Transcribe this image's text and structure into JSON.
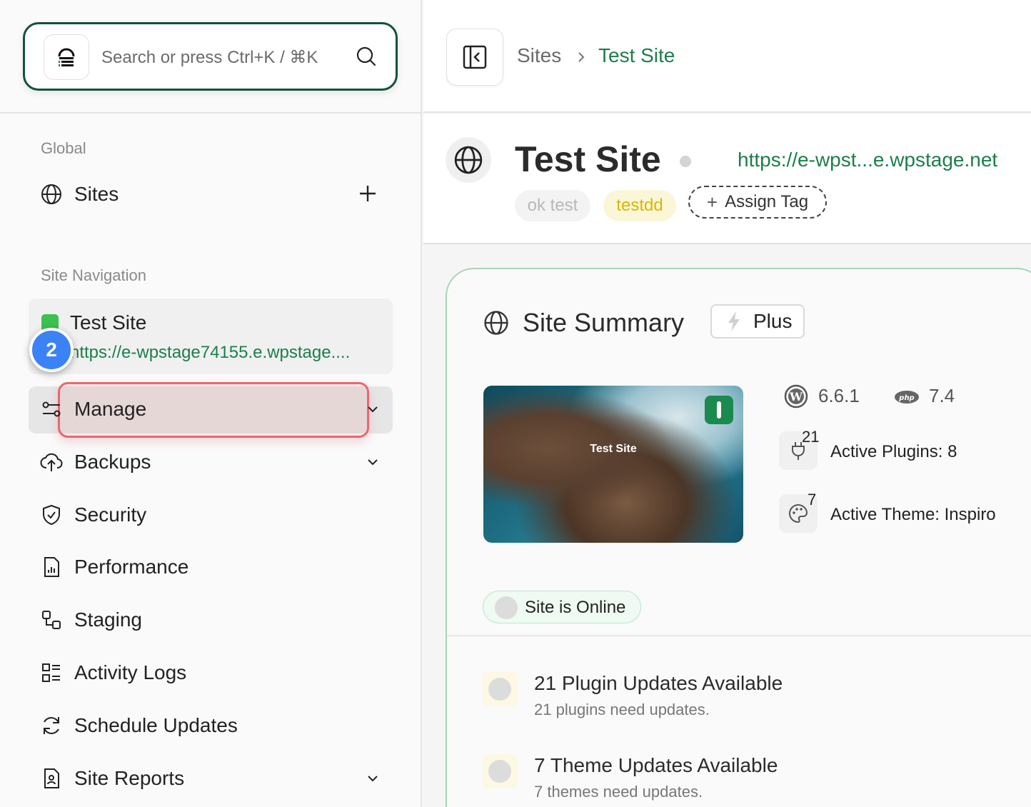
{
  "search": {
    "placeholder": "Search or press Ctrl+K / ⌘K"
  },
  "sidebar": {
    "global_label": "Global",
    "sites_label": "Sites",
    "site_nav_label": "Site Navigation",
    "current_site": {
      "name": "Test Site",
      "url": "https://e-wpstage74155.e.wpstage...."
    },
    "step_badge": "2",
    "items": [
      {
        "label": "Manage",
        "icon": "sliders-icon",
        "has_chevron": true
      },
      {
        "label": "Backups",
        "icon": "cloud-upload-icon",
        "has_chevron": true
      },
      {
        "label": "Security",
        "icon": "shield-check-icon",
        "has_chevron": false
      },
      {
        "label": "Performance",
        "icon": "file-chart-icon",
        "has_chevron": false
      },
      {
        "label": "Staging",
        "icon": "staging-icon",
        "has_chevron": false
      },
      {
        "label": "Activity Logs",
        "icon": "list-icon",
        "has_chevron": false
      },
      {
        "label": "Schedule Updates",
        "icon": "refresh-icon",
        "has_chevron": false
      },
      {
        "label": "Site Reports",
        "icon": "report-icon",
        "has_chevron": true
      }
    ]
  },
  "breadcrumb": {
    "parent": "Sites",
    "current": "Test Site"
  },
  "site": {
    "title": "Test Site",
    "url": "https://e-wpst...e.wpstage.net",
    "tags": [
      "ok test",
      "testdd"
    ],
    "assign_tag_label": "Assign Tag"
  },
  "summary": {
    "title": "Site Summary",
    "plan": "Plus",
    "thumbnail_title": "Test Site",
    "wp_version": "6.6.1",
    "php_version": "7.4",
    "plugins_count": "21",
    "active_plugins": "Active Plugins: 8",
    "themes_count": "7",
    "active_theme": "Active Theme: Inspiro",
    "status": "Site is Online"
  },
  "updates": [
    {
      "title": "21 Plugin Updates Available",
      "subtitle": "21 plugins need updates."
    },
    {
      "title": "7 Theme Updates Available",
      "subtitle": "7 themes need updates."
    }
  ],
  "colors": {
    "brand_green": "#1b7f4a",
    "search_border": "#14523a",
    "highlight": "#e8686f",
    "step_blue": "#3b82f6"
  }
}
